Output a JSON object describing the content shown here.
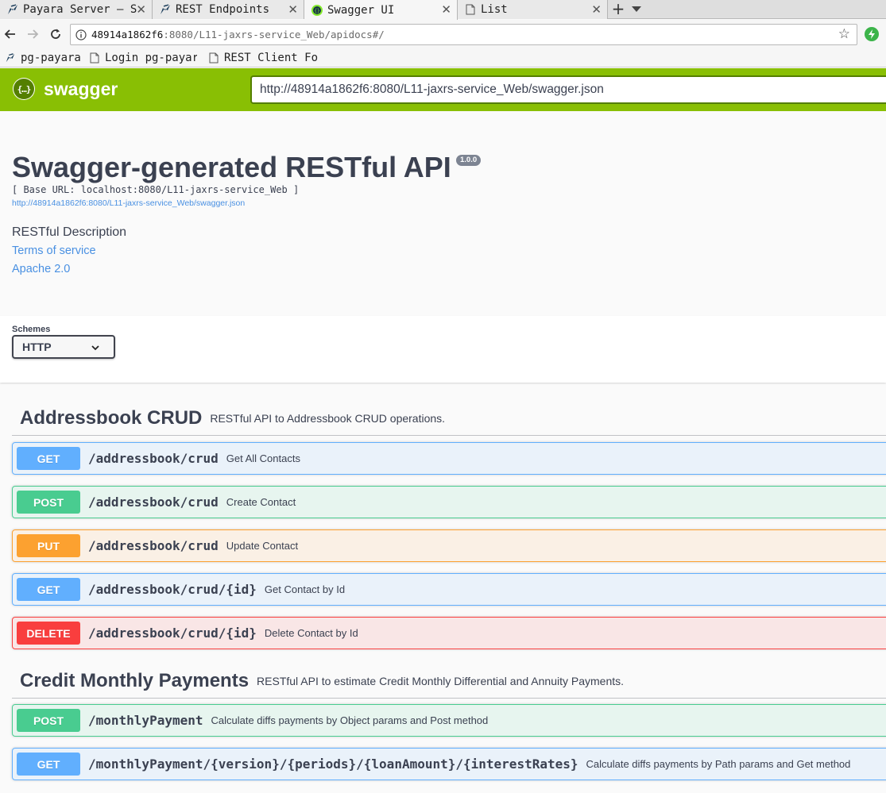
{
  "browser": {
    "tabs": [
      {
        "title": "Payara Server – S",
        "icon": "payara-icon"
      },
      {
        "title": "REST Endpoints",
        "icon": "payara-icon"
      },
      {
        "title": "Swagger UI",
        "icon": "swagger-favicon-icon"
      },
      {
        "title": "List",
        "icon": "page-icon"
      }
    ],
    "address": {
      "host": "48914a1862f6",
      "rest": ":8080/L11-jaxrs-service_Web/apidocs#/"
    },
    "bookmarks": [
      {
        "title": "pg-payara",
        "icon": "payara-icon"
      },
      {
        "title": "Login pg-payara",
        "icon": "page-icon"
      },
      {
        "title": "REST Client For",
        "icon": "page-icon"
      }
    ]
  },
  "swagger": {
    "logo_text": "swagger",
    "logo_mark": "{…}",
    "spec_url": "http://48914a1862f6:8080/L11-jaxrs-service_Web/swagger.json"
  },
  "info": {
    "title": "Swagger-generated RESTful API",
    "version": "1.0.0",
    "base_url": "[ Base URL: localhost:8080/L11-jaxrs-service_Web ]",
    "spec_link": "http://48914a1862f6:8080/L11-jaxrs-service_Web/swagger.json",
    "description": "RESTful Description",
    "terms": "Terms of service",
    "license": "Apache 2.0"
  },
  "schemes": {
    "label": "Schemes",
    "selected": "HTTP"
  },
  "tags": [
    {
      "name": "Addressbook CRUD",
      "description": "RESTful API to Addressbook CRUD operations.",
      "operations": [
        {
          "method": "GET",
          "path": "/addressbook/crud",
          "summary": "Get All Contacts"
        },
        {
          "method": "POST",
          "path": "/addressbook/crud",
          "summary": "Create Contact"
        },
        {
          "method": "PUT",
          "path": "/addressbook/crud",
          "summary": "Update Contact"
        },
        {
          "method": "GET",
          "path": "/addressbook/crud/{id}",
          "summary": "Get Contact by Id"
        },
        {
          "method": "DELETE",
          "path": "/addressbook/crud/{id}",
          "summary": "Delete Contact by Id"
        }
      ]
    },
    {
      "name": "Credit Monthly Payments",
      "description": "RESTful API to estimate Credit Monthly Differential and Annuity Payments.",
      "operations": [
        {
          "method": "POST",
          "path": "/monthlyPayment",
          "summary": "Calculate diffs payments by Object params and Post method"
        },
        {
          "method": "GET",
          "path": "/monthlyPayment/{version}/{periods}/{loanAmount}/{interestRates}",
          "summary": "Calculate diffs payments by Path params and Get method"
        }
      ]
    }
  ],
  "colors": {
    "topbar": "#89bf04",
    "get": "#61affe",
    "post": "#49cc90",
    "put": "#fca130",
    "delete": "#f93e3e"
  }
}
